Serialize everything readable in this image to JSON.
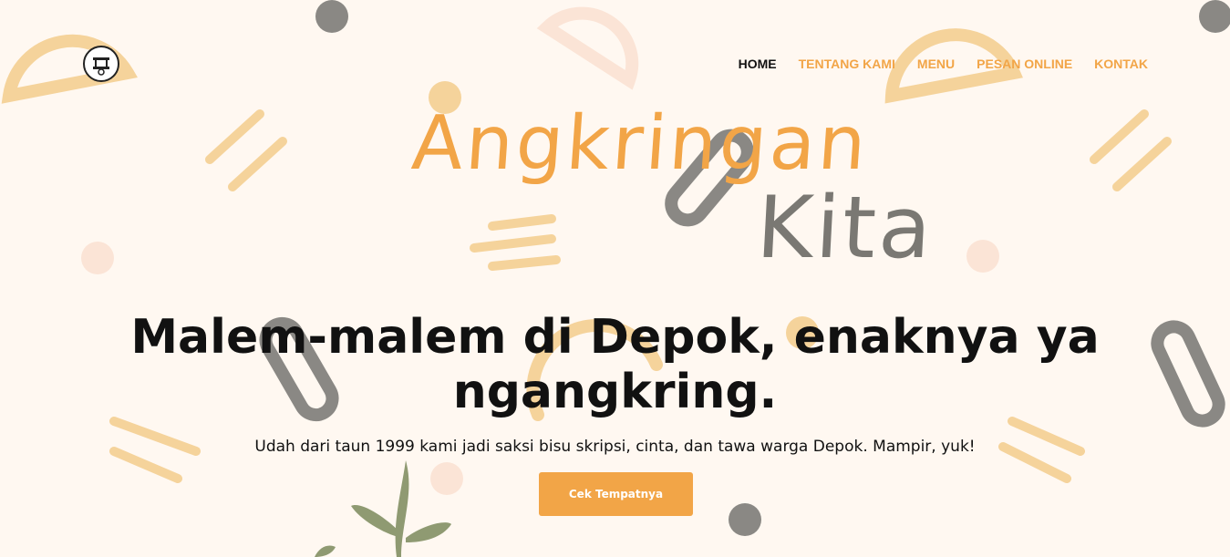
{
  "colors": {
    "background": "#fff8f1",
    "accent": "#f2a547",
    "gray": "#7a7873",
    "text": "#111111"
  },
  "header": {
    "logo_icon": "angkringan-cart-logo",
    "nav": [
      {
        "label": "HOME",
        "active": true
      },
      {
        "label": "TENTANG KAMI",
        "active": false
      },
      {
        "label": "MENU",
        "active": false
      },
      {
        "label": "PESAN ONLINE",
        "active": false
      },
      {
        "label": "KONTAK",
        "active": false
      }
    ]
  },
  "hero": {
    "brand_line1": "Angkringan",
    "brand_line2": "Kita",
    "headline": "Malem-malem di Depok, enaknya ya ngangkring.",
    "subtitle": "Udah dari taun 1999 kami jadi saksi bisu skripsi, cinta, dan tawa warga Depok. Mampir, yuk!",
    "cta_label": "Cek Tempatnya"
  }
}
